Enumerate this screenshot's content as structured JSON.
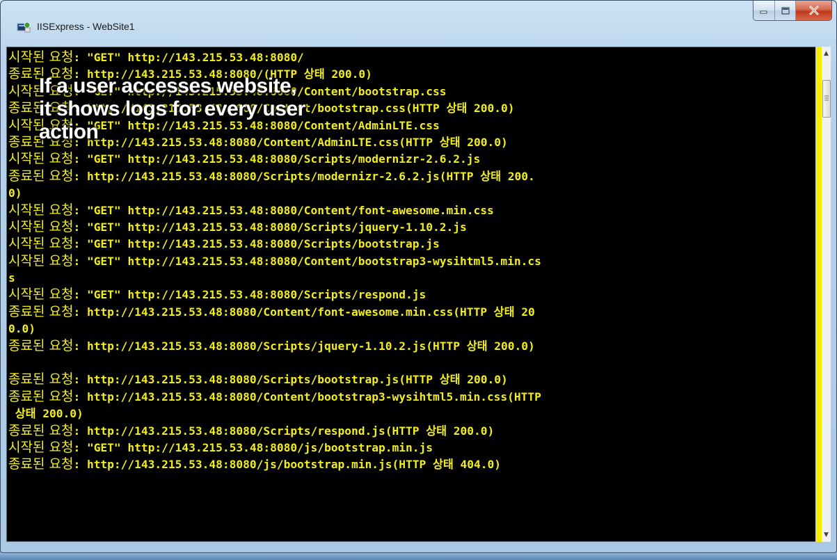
{
  "window": {
    "title": "IISExpress - WebSite1",
    "controls": {
      "minimize_icon": "minimize-icon",
      "maximize_icon": "maximize-icon",
      "close_icon": "close-icon"
    }
  },
  "overlay": {
    "lines": [
      "If a user accesses website,",
      "it shows logs for every user",
      "action"
    ]
  },
  "console": {
    "text_color": "#f2ee1c",
    "lines": [
      [
        "시작된 요청",
        ": \"GET\" http://143.215.53.48:8080/"
      ],
      [
        "종료된 요청",
        ": http://143.215.53.48:8080/(HTTP 상태 200.0)"
      ],
      [
        "시작된 요청",
        ": \"GET\" http://143.215.53.48:8080/Content/bootstrap.css"
      ],
      [
        "종료된 요청",
        ": http://143.215.53.48:8080/Content/bootstrap.css(HTTP 상태 200.0)"
      ],
      [
        "시작된 요청",
        ": \"GET\" http://143.215.53.48:8080/Content/AdminLTE.css"
      ],
      [
        "종료된 요청",
        ": http://143.215.53.48:8080/Content/AdminLTE.css(HTTP 상태 200.0)"
      ],
      [
        "시작된 요청",
        ": \"GET\" http://143.215.53.48:8080/Scripts/modernizr-2.6.2.js"
      ],
      [
        "종료된 요청",
        ": http://143.215.53.48:8080/Scripts/modernizr-2.6.2.js(HTTP 상태 200."
      ],
      [
        "",
        "0)"
      ],
      [
        "시작된 요청",
        ": \"GET\" http://143.215.53.48:8080/Content/font-awesome.min.css"
      ],
      [
        "시작된 요청",
        ": \"GET\" http://143.215.53.48:8080/Scripts/jquery-1.10.2.js"
      ],
      [
        "시작된 요청",
        ": \"GET\" http://143.215.53.48:8080/Scripts/bootstrap.js"
      ],
      [
        "시작된 요청",
        ": \"GET\" http://143.215.53.48:8080/Content/bootstrap3-wysihtml5.min.cs"
      ],
      [
        "",
        "s"
      ],
      [
        "시작된 요청",
        ": \"GET\" http://143.215.53.48:8080/Scripts/respond.js"
      ],
      [
        "종료된 요청",
        ": http://143.215.53.48:8080/Content/font-awesome.min.css(HTTP 상태 20"
      ],
      [
        "",
        "0.0)"
      ],
      [
        "종료된 요청",
        ": http://143.215.53.48:8080/Scripts/jquery-1.10.2.js(HTTP 상태 200.0)"
      ],
      [
        "",
        ""
      ],
      [
        "종료된 요청",
        ": http://143.215.53.48:8080/Scripts/bootstrap.js(HTTP 상태 200.0)"
      ],
      [
        "종료된 요청",
        ": http://143.215.53.48:8080/Content/bootstrap3-wysihtml5.min.css(HTTP"
      ],
      [
        "",
        " 상태 200.0)"
      ],
      [
        "종료된 요청",
        ": http://143.215.53.48:8080/Scripts/respond.js(HTTP 상태 200.0)"
      ],
      [
        "시작된 요청",
        ": \"GET\" http://143.215.53.48:8080/js/bootstrap.min.js"
      ],
      [
        "종료된 요청",
        ": http://143.215.53.48:8080/js/bootstrap.min.js(HTTP 상태 404.0)"
      ]
    ]
  },
  "scrollbar": {
    "up_icon": "scroll-up-arrow-icon",
    "down_icon": "scroll-down-arrow-icon"
  }
}
